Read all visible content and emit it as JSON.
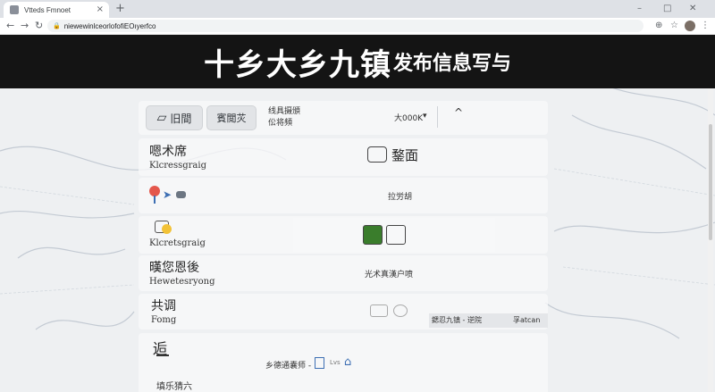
{
  "browser": {
    "tab_title": "Vtteds Fmnoet",
    "tab_close": "×",
    "new_tab": "+",
    "url": "niewewinlceorlofofiEOıyerfco",
    "window_controls": {
      "minimize": "–",
      "restore": "□",
      "close": "✕"
    }
  },
  "banner": {
    "title_large": "十乡大乡九镇",
    "title_small": "发布信息写与"
  },
  "rows": {
    "r1": {
      "btn1": "旧間",
      "btn2": "賓閲苂",
      "info_line1": "线具摄頒",
      "info_line2": "伀将頻",
      "select_value": "大000K",
      "caret": "▾",
      "collapse": "^"
    },
    "r2": {
      "title": "嗯术席",
      "subtitle": "Klcressgraig",
      "action": "鍪面"
    },
    "r3": {
      "center": "拉労胡"
    },
    "r4": {
      "subtitle": "Klcretsgraig"
    },
    "r5": {
      "title": "暵您恩後",
      "subtitle": "Hewetesryong",
      "center": "光术真漢户喷"
    },
    "r6": {
      "title": "共调",
      "subtitle": "Fomg",
      "chip_left": "鍶忍九镇 - 逆院",
      "chip_right": "孚atcan"
    },
    "r7": {
      "title": "逅",
      "text": "乡德通囊师 -",
      "tag": "Lvs",
      "footer": "填乐猜六"
    }
  },
  "colors": {
    "banner_bg": "#141414",
    "panel_bg": "#f8f9fa",
    "accent_green": "#3a7d2c",
    "icon_blue": "#3d6fb3"
  }
}
